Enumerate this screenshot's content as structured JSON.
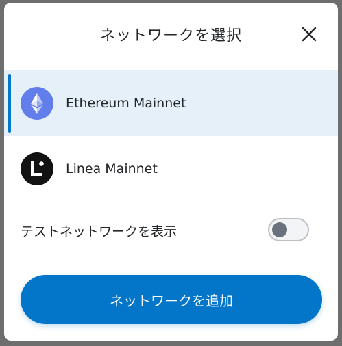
{
  "dialog": {
    "title": "ネットワークを選択",
    "close_icon": "close-icon"
  },
  "networks": [
    {
      "label": "Ethereum Mainnet",
      "icon": "ethereum-icon",
      "selected": true,
      "color": "#627eea"
    },
    {
      "label": "Linea Mainnet",
      "icon": "linea-icon",
      "selected": false,
      "color": "#121212"
    }
  ],
  "test_networks": {
    "label": "テストネットワークを表示",
    "enabled": false
  },
  "add_button": {
    "label": "ネットワークを追加",
    "color": "#0376c9"
  },
  "colors": {
    "accent": "#0376c9",
    "selected_row": "#e5f0f8",
    "text": "#24272a"
  }
}
